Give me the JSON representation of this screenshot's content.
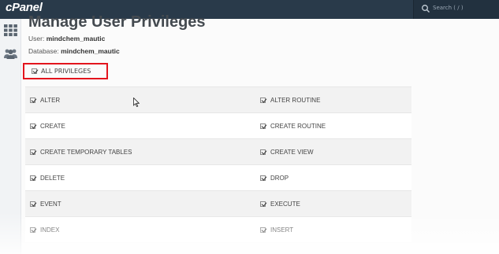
{
  "header": {
    "logo": "cPanel",
    "search_placeholder": "Search ( / )"
  },
  "page": {
    "title": "Manage User Privileges",
    "user_label": "User:",
    "user_value": "mindchem_mautic",
    "database_label": "Database:",
    "database_value": "mindchem_mautic"
  },
  "all_privileges": {
    "label": "ALL PRIVILEGES",
    "checked": true
  },
  "privileges": [
    {
      "left": "ALTER",
      "right": "ALTER ROUTINE"
    },
    {
      "left": "CREATE",
      "right": "CREATE ROUTINE"
    },
    {
      "left": "CREATE TEMPORARY TABLES",
      "right": "CREATE VIEW"
    },
    {
      "left": "DELETE",
      "right": "DROP"
    },
    {
      "left": "EVENT",
      "right": "EXECUTE"
    },
    {
      "left": "INDEX",
      "right": "INSERT"
    }
  ],
  "icons": {
    "sidebar": [
      "grid-icon",
      "users-icon"
    ],
    "search": "search-icon"
  },
  "colors": {
    "topbar": "#293a4a",
    "highlight_border": "#e3141d"
  }
}
